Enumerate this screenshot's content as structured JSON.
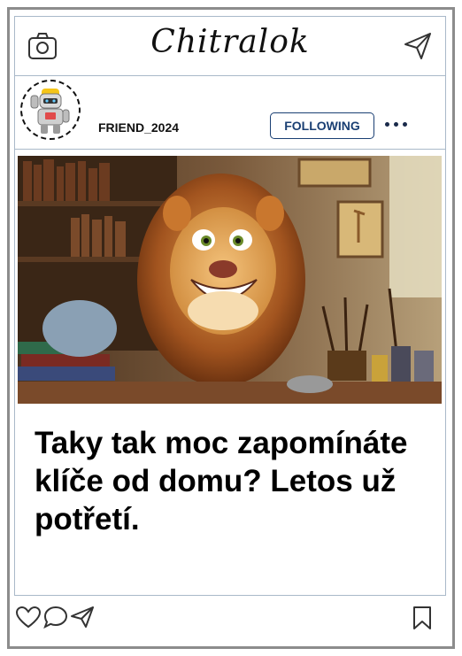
{
  "app": {
    "brand": "Chitralok"
  },
  "header": {
    "left_icon": "camera-icon",
    "right_icon": "send-icon"
  },
  "post": {
    "username": "FRIEND_2024",
    "follow_label": "FOLLOWING",
    "avatar_icon": "robot-avatar",
    "image_description_icon": "lion-illustration",
    "caption": "Taky tak moc zapomínáte klíče od domu? Letos už potřetí."
  },
  "actions": {
    "like_icon": "heart-icon",
    "comment_icon": "comment-icon",
    "share_icon": "send-icon",
    "save_icon": "bookmark-icon"
  },
  "colors": {
    "follow_accent": "#1a3f73",
    "frame_border": "#8c8c8c",
    "divider": "#a9b9c9"
  }
}
